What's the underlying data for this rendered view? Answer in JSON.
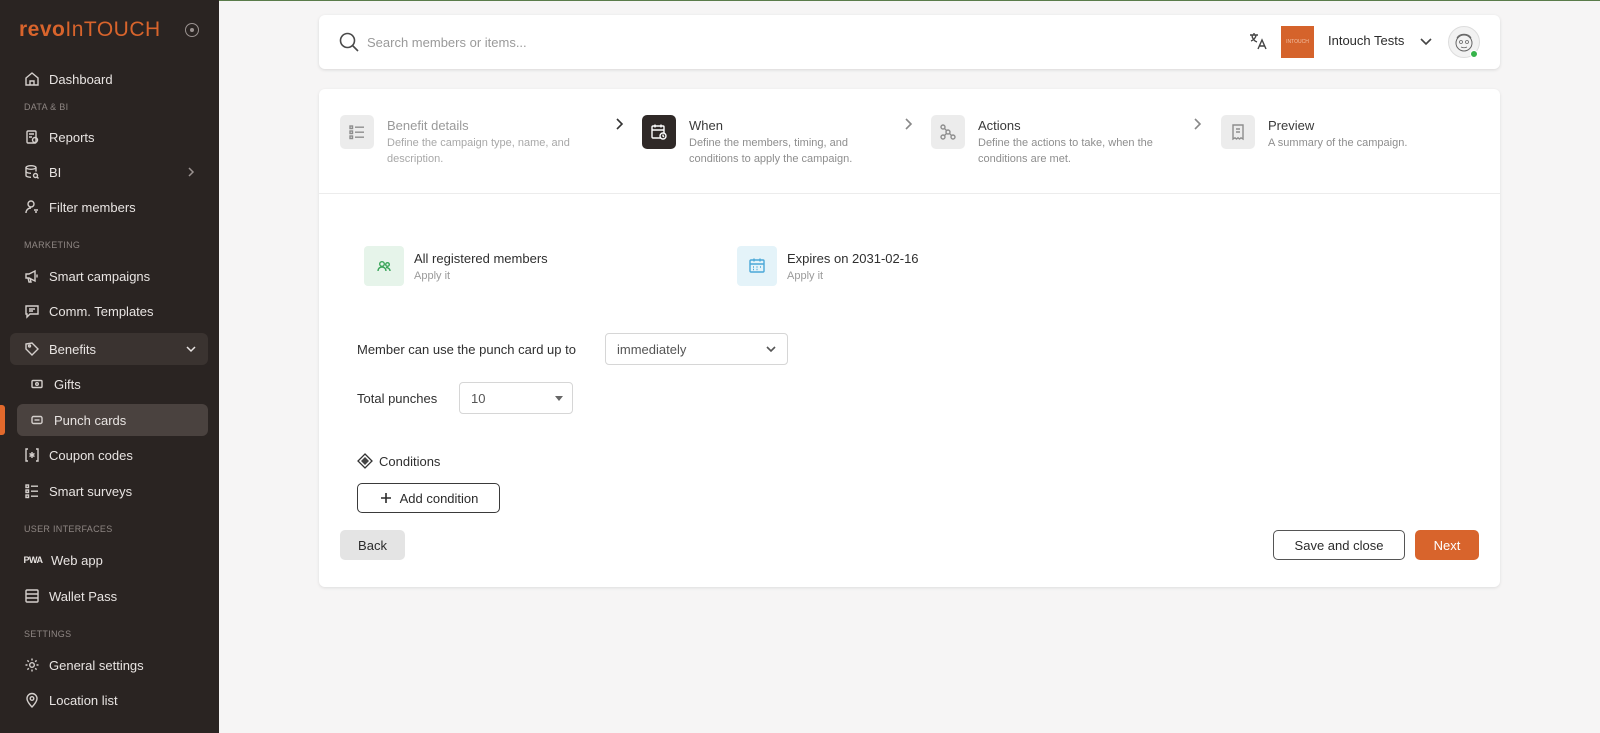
{
  "sidebar": {
    "logo": {
      "part1": "revo",
      "part2": "InTOUCH"
    },
    "sections": {
      "data_bi": "DATA & BI",
      "marketing": "MARKETING",
      "user_interfaces": "USER INTERFACES",
      "settings": "SETTINGS"
    },
    "items": {
      "dashboard": "Dashboard",
      "reports": "Reports",
      "bi": "BI",
      "filter_members": "Filter members",
      "smart_campaigns": "Smart campaigns",
      "comm_templates": "Comm. Templates",
      "benefits": "Benefits",
      "gifts": "Gifts",
      "punch_cards": "Punch cards",
      "coupon_codes": "Coupon codes",
      "smart_surveys": "Smart surveys",
      "web_app": "Web app",
      "wallet_pass": "Wallet Pass",
      "general_settings": "General settings",
      "location_list": "Location list"
    }
  },
  "header": {
    "search_placeholder": "Search members or items...",
    "account_name": "Intouch Tests",
    "brand_thumb_text": "INTOUCH"
  },
  "stepper": [
    {
      "title": "Benefit details",
      "desc": "Define the campaign type, name, and description.",
      "state": "done"
    },
    {
      "title": "When",
      "desc": "Define the members, timing, and conditions to apply the campaign.",
      "state": "current"
    },
    {
      "title": "Actions",
      "desc": "Define the actions to take, when the conditions are met.",
      "state": "pending"
    },
    {
      "title": "Preview",
      "desc": "A summary of the campaign.",
      "state": "pending"
    }
  ],
  "summary": {
    "members": {
      "title": "All registered members",
      "sub": "Apply it"
    },
    "expiry": {
      "title": "Expires on 2031-02-16",
      "sub": "Apply it"
    }
  },
  "form": {
    "usage_label": "Member can use the punch card up to",
    "usage_value": "immediately",
    "punches_label": "Total punches",
    "punches_value": "10",
    "conditions_title": "Conditions",
    "add_condition": "Add condition"
  },
  "actions": {
    "back": "Back",
    "save_close": "Save and close",
    "next": "Next"
  },
  "colors": {
    "accent": "#d8642c",
    "sidebar_bg": "#2a2422",
    "members_icon_bg": "#e6f4ea",
    "members_icon": "#3aa55a",
    "expiry_icon_bg": "#e4f3f9",
    "expiry_icon": "#4aa8d8"
  }
}
